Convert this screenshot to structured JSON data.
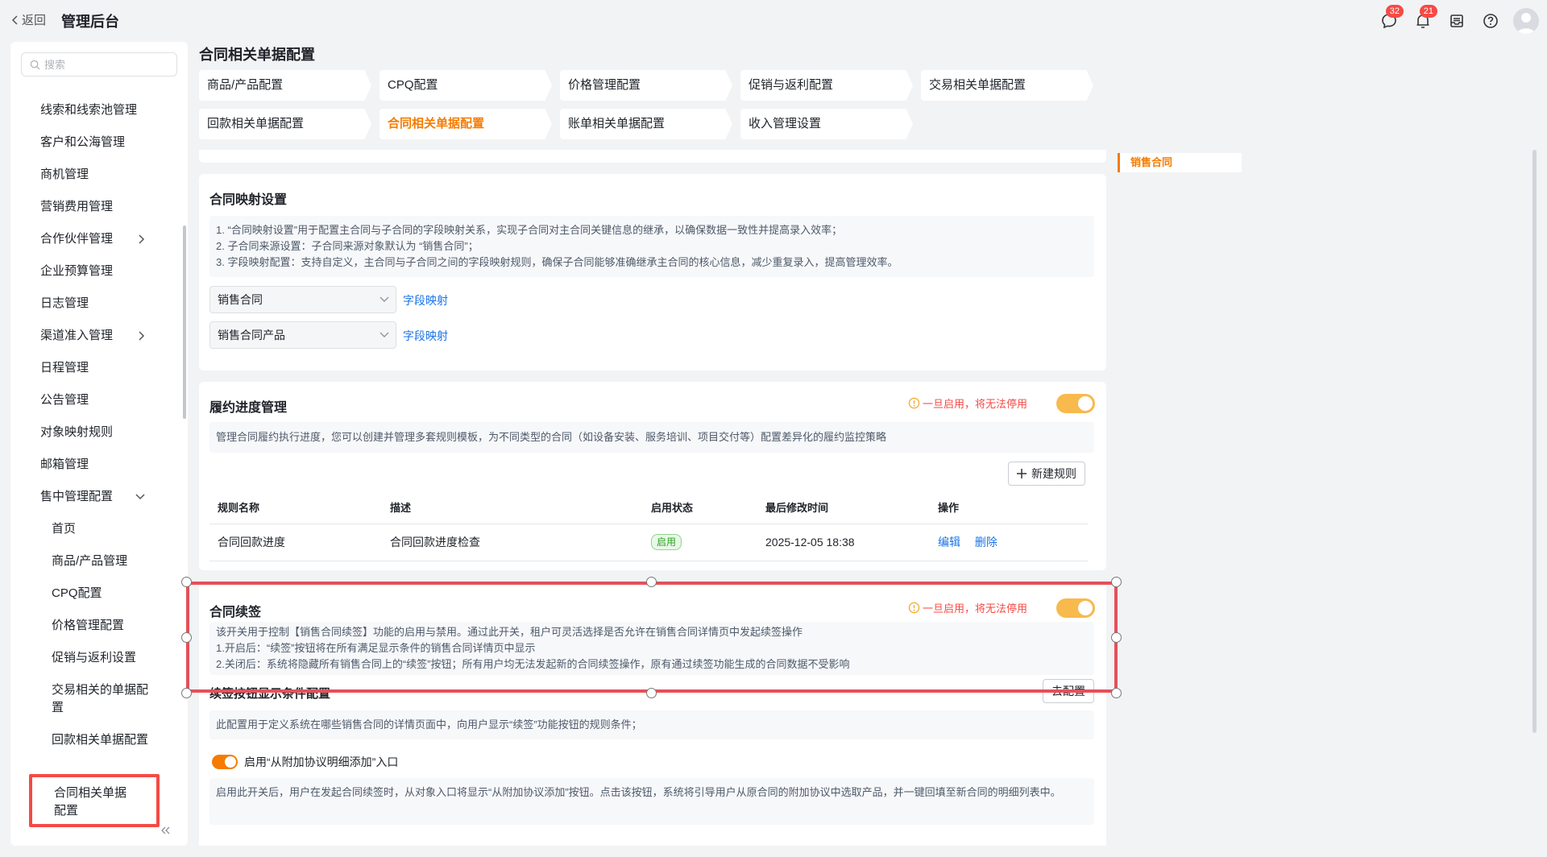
{
  "header": {
    "back_label": "返回",
    "app_title": "管理后台",
    "messages_badge": "32",
    "notifications_badge": "21"
  },
  "sidebar": {
    "search_placeholder": "搜索",
    "items": [
      {
        "label": "线索和线索池管理"
      },
      {
        "label": "客户和公海管理"
      },
      {
        "label": "商机管理"
      },
      {
        "label": "营销费用管理"
      },
      {
        "label": "合作伙伴管理"
      },
      {
        "label": "企业预算管理"
      },
      {
        "label": "日志管理"
      },
      {
        "label": "渠道准入管理"
      },
      {
        "label": "日程管理"
      },
      {
        "label": "公告管理"
      },
      {
        "label": "对象映射规则"
      },
      {
        "label": "邮箱管理"
      },
      {
        "label": "售中管理配置"
      }
    ],
    "sub_items": [
      {
        "label": "首页"
      },
      {
        "label": "商品/产品管理"
      },
      {
        "label": "CPQ配置"
      },
      {
        "label": "价格管理配置"
      },
      {
        "label": "促销与返利设置"
      },
      {
        "label": "交易相关的单据配置"
      },
      {
        "label": "回款相关单据配置"
      },
      {
        "label": "合同相关单据配置"
      }
    ]
  },
  "page": {
    "title": "合同相关单据配置",
    "tabs": [
      {
        "label": "商品/产品配置"
      },
      {
        "label": "CPQ配置"
      },
      {
        "label": "价格管理配置"
      },
      {
        "label": "促销与返利配置"
      },
      {
        "label": "交易相关单据配置"
      },
      {
        "label": "回款相关单据配置"
      },
      {
        "label": "合同相关单据配置"
      },
      {
        "label": "账单相关单据配置"
      },
      {
        "label": "收入管理设置"
      }
    ],
    "anchor": "销售合同"
  },
  "mapping": {
    "title": "合同映射设置",
    "desc": [
      "1. “合同映射设置”用于配置主合同与子合同的字段映射关系，实现子合同对主合同关键信息的继承，以确保数据一致性并提高录入效率；",
      "2. 子合同来源设置：子合同来源对象默认为 “销售合同”；",
      "3. 字段映射配置：支持自定义，主合同与子合同之间的字段映射规则，确保子合同能够准确继承主合同的核心信息，减少重复录入，提高管理效率。"
    ],
    "select1": "销售合同",
    "select2": "销售合同产品",
    "link": "字段映射"
  },
  "fulfillment": {
    "title": "履约进度管理",
    "warning": "一旦启用，将无法停用",
    "desc": "管理合同履约执行进度，您可以创建并管理多套规则模板，为不同类型的合同（如设备安装、服务培训、项目交付等）配置差异化的履约监控策略",
    "new_rule": "新建规则",
    "columns": [
      "规则名称",
      "描述",
      "启用状态",
      "最后修改时间",
      "操作"
    ],
    "rows": [
      {
        "name": "合同回款进度",
        "desc": "合同回款进度检查",
        "status": "启用",
        "time": "2025-12-05 18:38",
        "edit": "编辑",
        "delete": "删除"
      }
    ]
  },
  "renewal": {
    "title": "合同续签",
    "warning": "一旦启用，将无法停用",
    "desc": [
      "该开关用于控制【销售合同续签】功能的启用与禁用。通过此开关，租户可灵活选择是否允许在销售合同详情页中发起续签操作",
      "1.开启后：“续签”按钮将在所有满足显示条件的销售合同详情页中显示",
      "2.关闭后：系统将隐藏所有销售合同上的“续签”按钮；所有用户均无法发起新的合同续签操作，原有通过续签功能生成的合同数据不受影响"
    ],
    "condition_title": "续签按钮显示条件配置",
    "configure": "去配置",
    "condition_desc": "此配置用于定义系统在哪些销售合同的详情页面中，向用户显示“续签”功能按钮的规则条件；",
    "addon_toggle_label": "启用“从附加协议明细添加”入口",
    "addon_desc": "启用此开关后，用户在发起合同续签时，从对象入口将显示“从附加协议添加”按钮。点击该按钮，系统将引导用户从原合同的附加协议中选取产品，并一键回填至新合同的明细列表中。"
  }
}
